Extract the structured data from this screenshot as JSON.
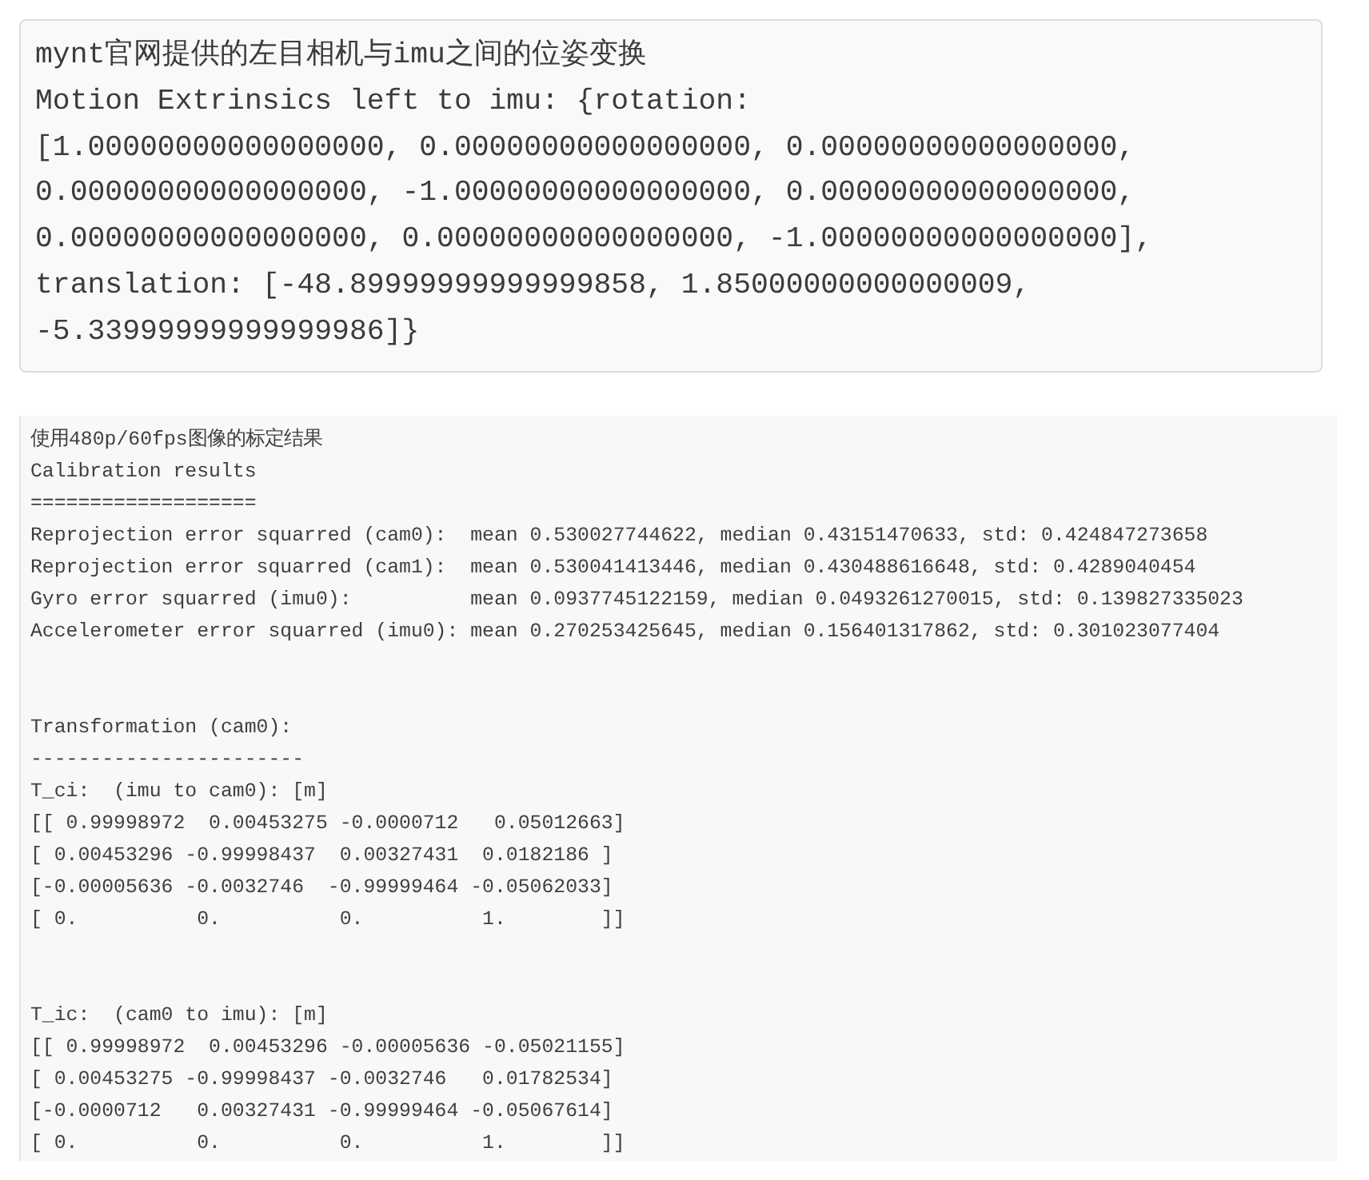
{
  "code_block_1": {
    "lines": [
      "mynt官网提供的左目相机与imu之间的位姿变换",
      "Motion Extrinsics left to imu: {rotation:",
      "[1.00000000000000000, 0.00000000000000000, 0.00000000000000000,",
      "0.00000000000000000, -1.00000000000000000, 0.00000000000000000,",
      "0.00000000000000000, 0.00000000000000000, -1.00000000000000000],",
      "translation: [-48.89999999999999858, 1.85000000000000009,",
      "-5.33999999999999986]}"
    ]
  },
  "code_block_2": {
    "sections": [
      [
        "使用480p/60fps图像的标定结果",
        "Calibration results",
        "===================",
        "Reprojection error squarred (cam0):  mean 0.530027744622, median 0.43151470633, std: 0.424847273658",
        "Reprojection error squarred (cam1):  mean 0.530041413446, median 0.430488616648, std: 0.4289040454",
        "Gyro error squarred (imu0):          mean 0.0937745122159, median 0.0493261270015, std: 0.139827335023",
        "Accelerometer error squarred (imu0): mean 0.270253425645, median 0.156401317862, std: 0.301023077404"
      ],
      [
        "Transformation (cam0):",
        "-----------------------",
        "T_ci:  (imu to cam0): [m]",
        "[[ 0.99998972  0.00453275 -0.0000712   0.05012663]",
        "[ 0.00453296 -0.99998437  0.00327431  0.0182186 ]",
        "[-0.00005636 -0.0032746  -0.99999464 -0.05062033]",
        "[ 0.          0.          0.          1.        ]]"
      ],
      [
        "T_ic:  (cam0 to imu): [m]",
        "[[ 0.99998972  0.00453296 -0.00005636 -0.05021155]",
        "[ 0.00453275 -0.99998437 -0.0032746   0.01782534]",
        "[-0.0000712   0.00327431 -0.99999464 -0.05067614]",
        "[ 0.          0.          0.          1.        ]]"
      ]
    ]
  }
}
